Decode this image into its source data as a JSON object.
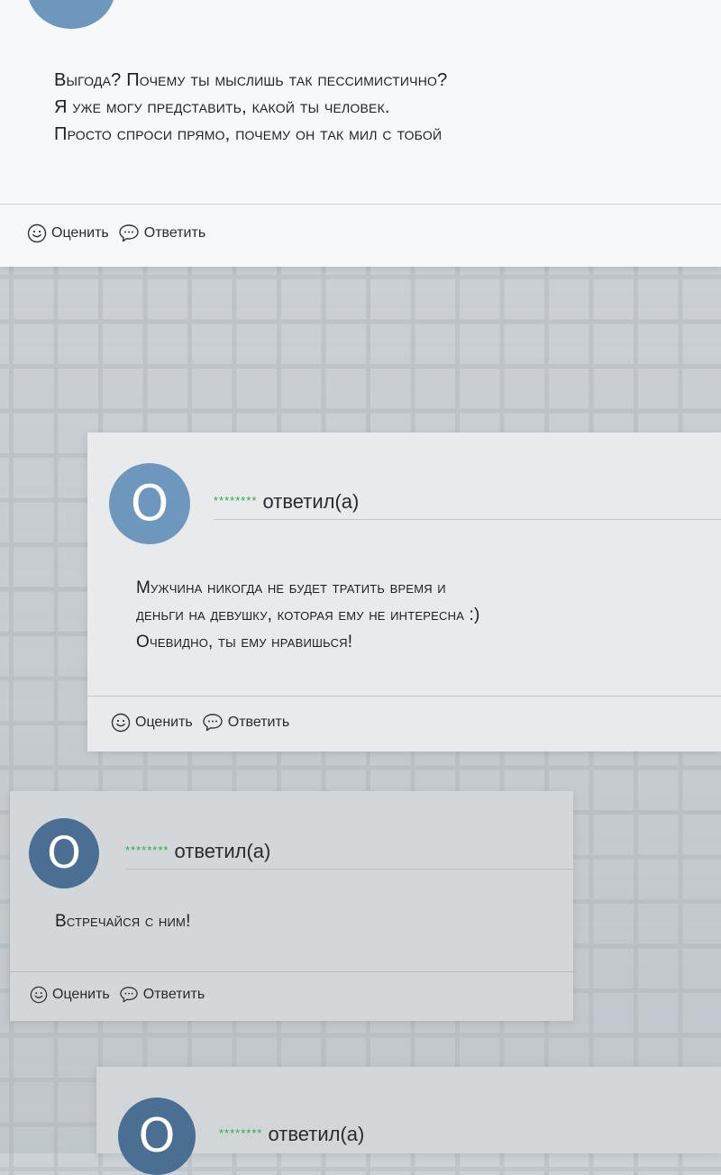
{
  "actions": {
    "rate_label": "Оценить",
    "reply_label": "Ответить"
  },
  "top_comment": {
    "lines": [
      "Выгода? Почему ты мыслишь так пессимистично?",
      "Я уже могу представить, какой ты человек.",
      "Просто спроси прямо, почему он так мил с тобой"
    ]
  },
  "replies": [
    {
      "avatar_letter": "O",
      "user_name": "********",
      "replied_label": "ответил(а)",
      "lines": [
        "Мужчина никогда не будет тратить время и",
        "деньги на девушку, которая ему не интересна :)",
        "Очевидно, ты ему нравишься!"
      ]
    },
    {
      "avatar_letter": "O",
      "user_name": "********",
      "replied_label": "ответил(а)",
      "lines": [
        "Встречайся с ним!"
      ]
    },
    {
      "avatar_letter": "O",
      "user_name": "********",
      "replied_label": "ответил(а)"
    }
  ],
  "colors": {
    "avatar_light": "#6e97bd",
    "avatar_dark": "#4a6f93",
    "user_name": "#22b14c"
  }
}
